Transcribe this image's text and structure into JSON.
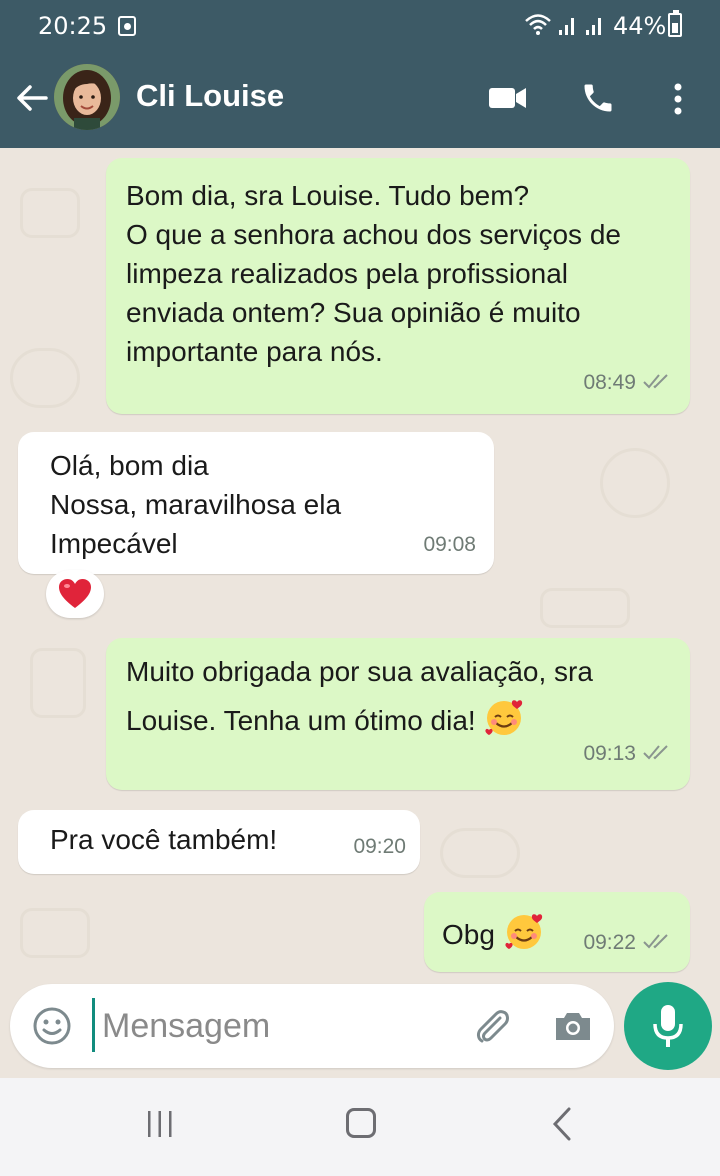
{
  "status_bar": {
    "time": "20:25",
    "battery": "44%"
  },
  "header": {
    "contact_name": "Cli Louise"
  },
  "messages": [
    {
      "direction": "outgoing",
      "text": "Bom dia, sra Louise. Tudo bem?\nO que a senhora achou dos serviços de limpeza realizados pela profissional enviada ontem? Sua opinião é muito importante para nós.",
      "time": "08:49",
      "status": "read"
    },
    {
      "direction": "incoming",
      "text": "Olá, bom dia\nNossa, maravilhosa ela\nImpecável",
      "time": "09:08",
      "reaction": "heart-icon"
    },
    {
      "direction": "outgoing",
      "text": "Muito obrigada por sua avaliação, sra Louise. Tenha um ótimo dia!",
      "emoji": "smiling-face-with-hearts-icon",
      "time": "09:13",
      "status": "read"
    },
    {
      "direction": "incoming",
      "text": "Pra você também!",
      "time": "09:20"
    },
    {
      "direction": "outgoing",
      "text": "Obg",
      "emoji": "smiling-face-with-hearts-icon",
      "time": "09:22",
      "status": "read"
    }
  ],
  "input": {
    "placeholder": "Mensagem"
  },
  "colors": {
    "header": "#3d5a66",
    "outgoing_bubble": "#dcf8c6",
    "incoming_bubble": "#ffffff",
    "accent": "#1fa885",
    "chat_background": "#ece5dd"
  }
}
